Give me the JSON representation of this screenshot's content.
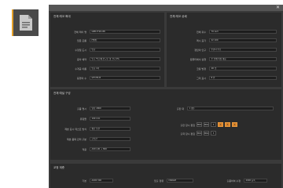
{
  "sidebar": {
    "icon": "document-icon",
    "accent": "#e6a129"
  },
  "window": {
    "close_glyph": "✕"
  },
  "panels": {
    "p1": {
      "title": "전체 레코 확대",
      "rows": [
        {
          "label": "전체 레이 명",
          "value": "G8B-YT2D-88"
        },
        {
          "label": "입문 모름",
          "value": "[빨렌]"
        },
        {
          "label": "수정일 도시",
          "value": "빈글"
        },
        {
          "label": "중차 예약",
          "value": "인구 백 한례 인구로 및 크다 0%"
        },
        {
          "label": "수개공 이름",
          "value": "빈글 1차"
        },
        {
          "label": "등행의 수",
          "value": "GFCHS B"
        }
      ]
    },
    "p2": {
      "title": "전체 레코 상쇄",
      "rows": [
        {
          "label": "전체 휘수",
          "value": "70 rect"
        },
        {
          "label": "레시 표기",
          "value": "22 100"
        },
        {
          "label": "정답의 인구",
          "value": "수관시 주로"
        },
        {
          "label": "컴퓨터에서 실행",
          "value": "주 만에 이상 대응"
        },
        {
          "label": "코팅 방정",
          "value": "2D 입"
        },
        {
          "label": "그리 표시",
          "value": "8 번"
        }
      ]
    },
    "p3": {
      "title": "전체 예설 구성",
      "rows": [
        {
          "label": "출품 명시",
          "value": "양강 1800"
        },
        {
          "label": "유령들",
          "value": "100 mm"
        },
        {
          "label": "제본 표시 테스트 방식",
          "value": "평균 보관"
        },
        {
          "label": "제본 품목 관리 구분",
          "value": "균보관"
        },
        {
          "label": "적용",
          "value": "A00 L00 + 800"
        }
      ],
      "right_label": "출판 대",
      "right_value": "1 (상)",
      "btn_rows": [
        {
          "label": "출판 장시 편집",
          "buttons": [
            "MR1",
            "MR2",
            "3",
            "4",
            "5",
            "6"
          ],
          "active": [
            3,
            4,
            5
          ]
        },
        {
          "label": "출력 장시 편집",
          "buttons": [
            "MR1",
            "MR2",
            "3"
          ],
          "active": []
        }
      ]
    },
    "p4": {
      "title": "교정 계층",
      "items": [
        {
          "label": "기본",
          "value": "A000 300"
        },
        {
          "label": "입출 정류",
          "value": "DSRAM"
        },
        {
          "label": "출품하여 수정",
          "value": "2000 등록"
        }
      ]
    }
  }
}
